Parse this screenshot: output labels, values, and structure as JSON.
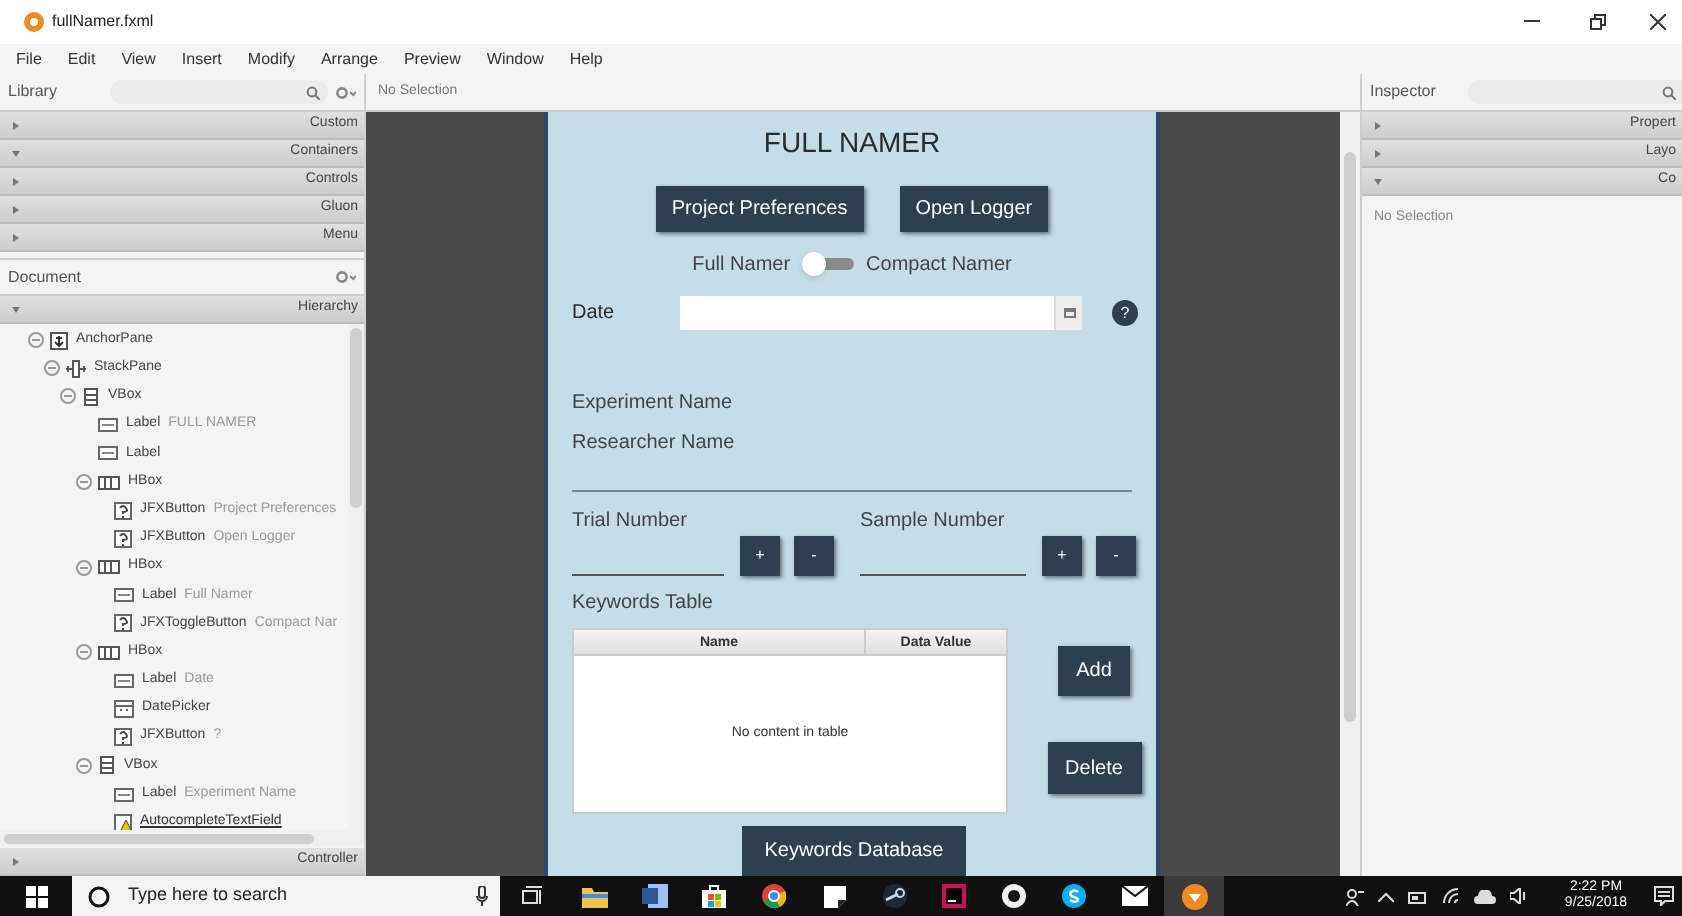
{
  "window": {
    "title": "fullNamer.fxml"
  },
  "menu": [
    "File",
    "Edit",
    "View",
    "Insert",
    "Modify",
    "Arrange",
    "Preview",
    "Window",
    "Help"
  ],
  "library": {
    "title": "Library",
    "sections": [
      {
        "label": "Custom",
        "expanded": false
      },
      {
        "label": "Containers",
        "expanded": true
      },
      {
        "label": "Controls",
        "expanded": false
      },
      {
        "label": "Gluon",
        "expanded": false
      },
      {
        "label": "Menu",
        "expanded": false
      }
    ]
  },
  "document": {
    "title": "Document",
    "hierarchy": {
      "label": "Hierarchy",
      "expanded": true
    },
    "tree": [
      {
        "kind": "anchor",
        "type": "AnchorPane",
        "expanded": true,
        "children": [
          {
            "kind": "stack",
            "type": "StackPane",
            "expanded": true,
            "children": [
              {
                "kind": "vbox",
                "type": "VBox",
                "expanded": true,
                "children": [
                  {
                    "kind": "label",
                    "type": "Label",
                    "text": "FULL NAMER"
                  },
                  {
                    "kind": "label",
                    "type": "Label"
                  },
                  {
                    "kind": "hbox",
                    "type": "HBox",
                    "expanded": true,
                    "children": [
                      {
                        "kind": "unknown",
                        "type": "JFXButton",
                        "text": "Project Preferences"
                      },
                      {
                        "kind": "unknown",
                        "type": "JFXButton",
                        "text": "Open Logger"
                      }
                    ]
                  },
                  {
                    "kind": "hbox",
                    "type": "HBox",
                    "expanded": true,
                    "children": [
                      {
                        "kind": "label",
                        "type": "Label",
                        "text": "Full Namer"
                      },
                      {
                        "kind": "unknown",
                        "type": "JFXToggleButton",
                        "text": "Compact Nar"
                      }
                    ]
                  },
                  {
                    "kind": "hbox",
                    "type": "HBox",
                    "expanded": true,
                    "children": [
                      {
                        "kind": "label",
                        "type": "Label",
                        "text": "Date"
                      },
                      {
                        "kind": "datepicker",
                        "type": "DatePicker"
                      },
                      {
                        "kind": "unknown",
                        "type": "JFXButton",
                        "text": "?"
                      }
                    ]
                  },
                  {
                    "kind": "vbox",
                    "type": "VBox",
                    "expanded": true,
                    "children": [
                      {
                        "kind": "label",
                        "type": "Label",
                        "text": "Experiment Name"
                      },
                      {
                        "kind": "warning",
                        "type": "AutocompleteTextField"
                      }
                    ]
                  }
                ]
              }
            ]
          }
        ]
      }
    ],
    "controller": {
      "label": "Controller",
      "expanded": false
    }
  },
  "canvas": {
    "selection": "No Selection",
    "form": {
      "title": "FULL NAMER",
      "buttons": [
        "Project Preferences",
        "Open Logger"
      ],
      "toggle": {
        "left_label": "Full Namer",
        "right_label": "Compact Namer",
        "on": false
      },
      "date": {
        "label": "Date",
        "help": "?"
      },
      "experiment_label": "Experiment Name",
      "researcher_label": "Researcher Name",
      "counters": [
        {
          "label": "Trial Number",
          "plus": "+",
          "minus": "-"
        },
        {
          "label": "Sample Number",
          "plus": "+",
          "minus": "-"
        }
      ],
      "keywords_label": "Keywords Table",
      "table": {
        "columns": [
          "Name",
          "Data Value"
        ],
        "placeholder": "No content in table"
      },
      "add_button": "Add",
      "delete_button": "Delete",
      "database_button": "Keywords Database"
    }
  },
  "inspector": {
    "title": "Inspector",
    "sections": [
      {
        "label": "Propert",
        "expanded": false
      },
      {
        "label": "Layo",
        "expanded": false
      },
      {
        "label": "Co",
        "expanded": true
      }
    ],
    "selection": "No Selection"
  },
  "taskbar": {
    "search_placeholder": "Type here to search",
    "time": "2:22 PM",
    "date": "9/25/2018"
  }
}
